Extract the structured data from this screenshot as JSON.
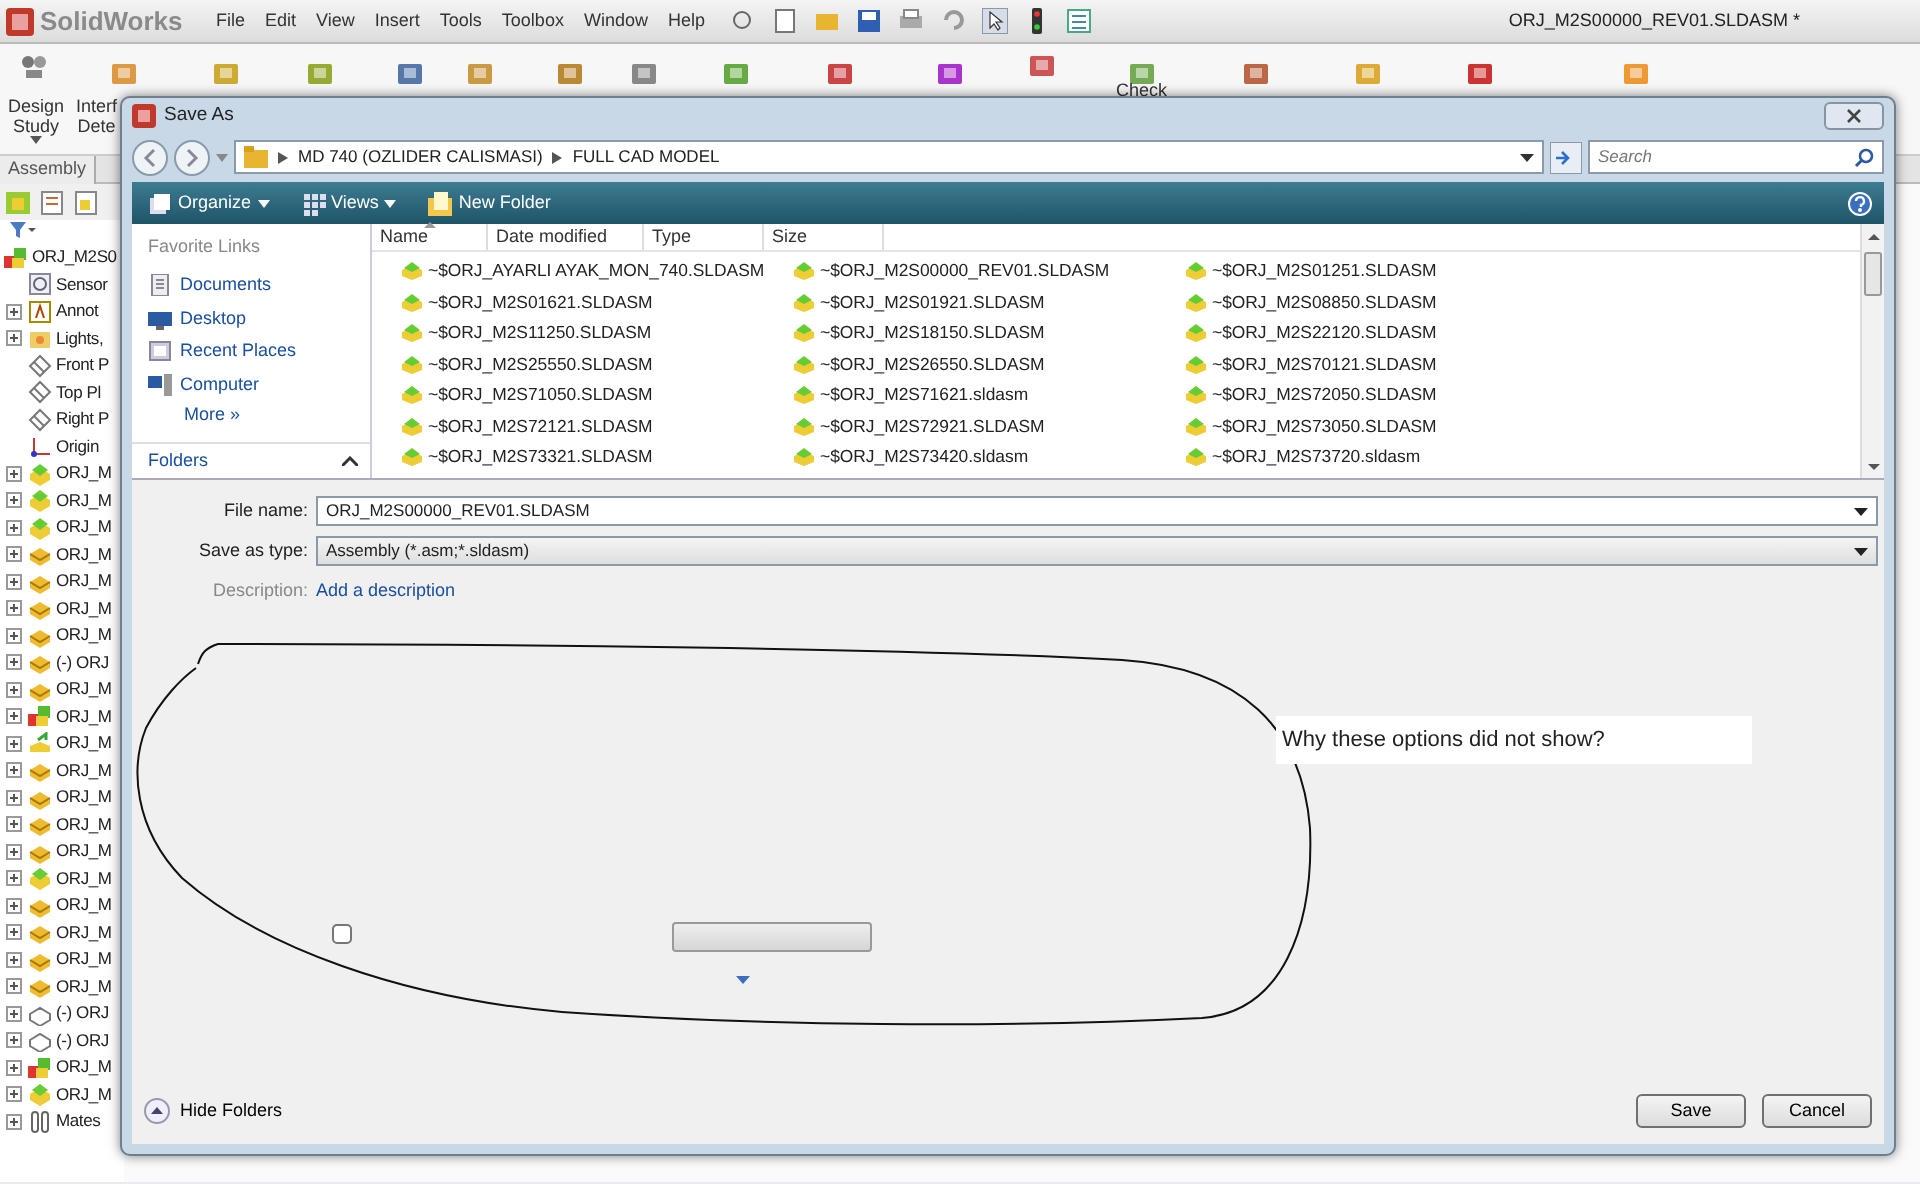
{
  "app": {
    "logo": "SolidWorks",
    "menu": [
      "File",
      "Edit",
      "View",
      "Insert",
      "Tools",
      "Toolbox",
      "Window",
      "Help"
    ],
    "title": "ORJ_M2S00000_REV01.SLDASM *"
  },
  "ribbon": {
    "labeled": [
      {
        "lines": [
          "Design",
          "Study"
        ]
      },
      {
        "lines": [
          "Interf",
          "Dete"
        ]
      }
    ],
    "check_label": "Check"
  },
  "command_tab": "Assembly",
  "tree": {
    "root": {
      "label": "ORJ_M2S0",
      "kind": "top",
      "children": [
        {
          "label": "Sensor",
          "kind": "sensor"
        },
        {
          "label": "Annot",
          "kind": "annotation",
          "expanded": false
        },
        {
          "label": "Lights,",
          "kind": "lights",
          "expanded": false
        },
        {
          "label": "Front P",
          "kind": "plane"
        },
        {
          "label": "Top Pl",
          "kind": "plane"
        },
        {
          "label": "Right P",
          "kind": "plane"
        },
        {
          "label": "Origin",
          "kind": "origin"
        },
        {
          "label": "ORJ_M",
          "kind": "assembly",
          "expanded": false
        },
        {
          "label": "ORJ_M",
          "kind": "assembly",
          "expanded": false
        },
        {
          "label": "ORJ_M",
          "kind": "assembly",
          "expanded": false
        },
        {
          "label": "ORJ_M",
          "kind": "component",
          "expanded": false
        },
        {
          "label": "ORJ_M",
          "kind": "component",
          "expanded": false
        },
        {
          "label": "ORJ_M",
          "kind": "component",
          "expanded": false
        },
        {
          "label": "ORJ_M",
          "kind": "component",
          "expanded": false
        },
        {
          "label": "(-) ORJ",
          "kind": "component",
          "expanded": false
        },
        {
          "label": "ORJ_M",
          "kind": "component",
          "expanded": false
        },
        {
          "label": "ORJ_M",
          "kind": "top",
          "expanded": false
        },
        {
          "label": "ORJ_M",
          "kind": "moved",
          "expanded": false
        },
        {
          "label": "ORJ_M",
          "kind": "component",
          "expanded": false
        },
        {
          "label": "ORJ_M",
          "kind": "component",
          "expanded": false
        },
        {
          "label": "ORJ_M",
          "kind": "component",
          "expanded": false
        },
        {
          "label": "ORJ_M",
          "kind": "component",
          "expanded": false
        },
        {
          "label": "ORJ_M",
          "kind": "assembly",
          "expanded": false
        },
        {
          "label": "ORJ_M",
          "kind": "component",
          "expanded": false
        },
        {
          "label": "ORJ_M",
          "kind": "component",
          "expanded": false
        },
        {
          "label": "ORJ_M",
          "kind": "component",
          "expanded": false
        },
        {
          "label": "ORJ_M",
          "kind": "component",
          "expanded": false
        },
        {
          "label": "(-) ORJ",
          "kind": "virtual",
          "expanded": false
        },
        {
          "label": "(-) ORJ",
          "kind": "virtual",
          "expanded": false
        },
        {
          "label": "ORJ_M",
          "kind": "top",
          "expanded": false
        },
        {
          "label": "ORJ_M",
          "kind": "assembly",
          "expanded": false
        },
        {
          "label": "Mates",
          "kind": "mates",
          "expanded": false
        }
      ]
    }
  },
  "dialog": {
    "title": "Save As",
    "breadcrumb": [
      "MD 740 (OZLIDER CALISMASI)",
      "FULL CAD MODEL"
    ],
    "search": {
      "placeholder": "Search"
    },
    "toolbar": [
      {
        "label": "Organize",
        "kind": "menu"
      },
      {
        "label": "Views",
        "kind": "views"
      },
      {
        "label": "New Folder",
        "kind": "folder"
      }
    ],
    "nav": {
      "heading": "Favorite Links",
      "links": [
        {
          "label": "Documents",
          "kind": "documents"
        },
        {
          "label": "Desktop",
          "kind": "desktop"
        },
        {
          "label": "Recent Places",
          "kind": "recent"
        },
        {
          "label": "Computer",
          "kind": "computer"
        }
      ],
      "more": "More",
      "more_mark": "»",
      "folders": "Folders"
    },
    "columns": [
      "Name",
      "Date modified",
      "Type",
      "Size"
    ],
    "files": [
      [
        "~$ORJ_AYARLI AYAK_MON_740.SLDASM",
        "~$ORJ_M2S01621.SLDASM",
        "~$ORJ_M2S11250.SLDASM",
        "~$ORJ_M2S25550.SLDASM",
        "~$ORJ_M2S71050.SLDASM",
        "~$ORJ_M2S72121.SLDASM",
        "~$ORJ_M2S73321.SLDASM"
      ],
      [
        "~$ORJ_M2S00000_REV01.SLDASM",
        "~$ORJ_M2S01921.SLDASM",
        "~$ORJ_M2S18150.SLDASM",
        "~$ORJ_M2S26550.SLDASM",
        "~$ORJ_M2S71621.sldasm",
        "~$ORJ_M2S72921.SLDASM",
        "~$ORJ_M2S73420.sldasm"
      ],
      [
        "~$ORJ_M2S01251.SLDASM",
        "~$ORJ_M2S08850.SLDASM",
        "~$ORJ_M2S22120.SLDASM",
        "~$ORJ_M2S70121.SLDASM",
        "~$ORJ_M2S72050.SLDASM",
        "~$ORJ_M2S73050.SLDASM",
        "~$ORJ_M2S73720.sldasm"
      ]
    ],
    "file_name": {
      "label": "File name:",
      "value": "ORJ_M2S00000_REV01.SLDASM"
    },
    "save_as_type": {
      "label": "Save as type:",
      "value": "Assembly (*.asm;*.sldasm)"
    },
    "description": {
      "label": "Description:",
      "link": "Add a description"
    },
    "note": "Why these options did not show?",
    "checkbox": {
      "checked": false
    },
    "hide_folders": "Hide Folders",
    "buttons": [
      "Save",
      "Cancel"
    ]
  }
}
